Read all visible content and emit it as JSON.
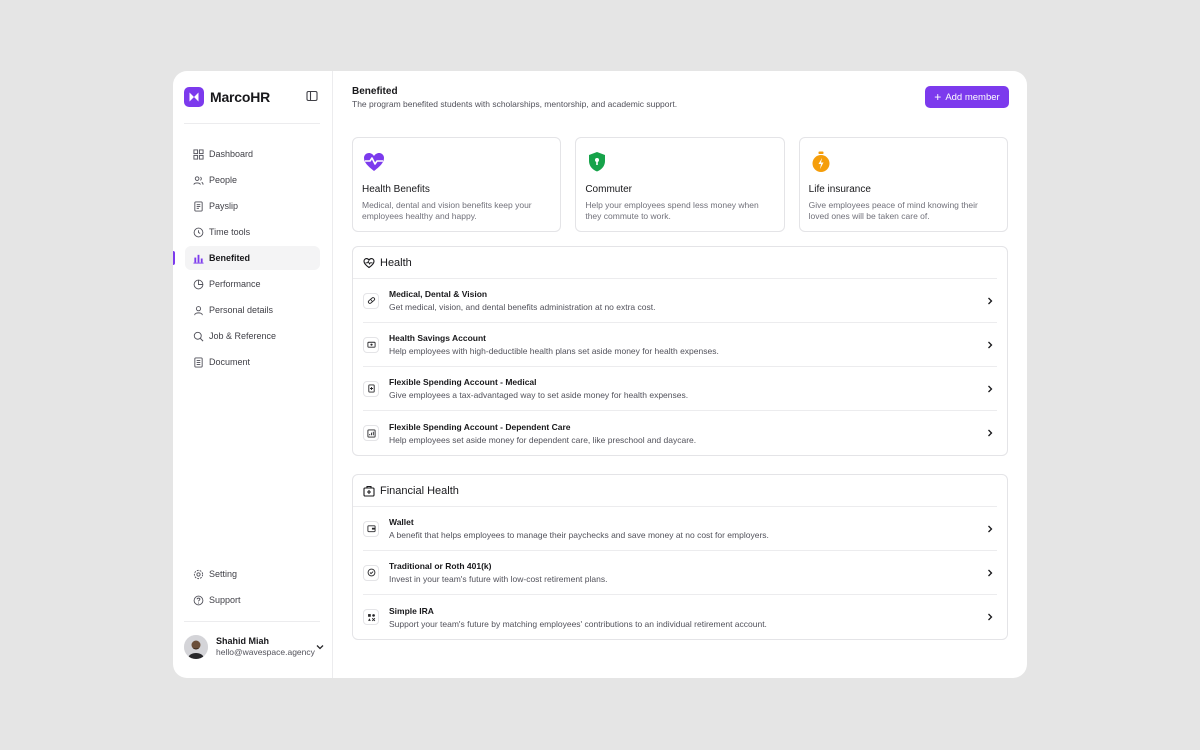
{
  "brand": {
    "name": "MarcoHR"
  },
  "nav": {
    "items": [
      {
        "label": "Dashboard",
        "icon": "grid-icon"
      },
      {
        "label": "People",
        "icon": "users-icon"
      },
      {
        "label": "Payslip",
        "icon": "receipt-icon"
      },
      {
        "label": "Time tools",
        "icon": "clock-icon"
      },
      {
        "label": "Benefited",
        "icon": "bar-chart-icon",
        "active": true
      },
      {
        "label": "Performance",
        "icon": "pie-chart-icon"
      },
      {
        "label": "Personal details",
        "icon": "user-icon"
      },
      {
        "label": "Job & Reference",
        "icon": "search-icon"
      },
      {
        "label": "Document",
        "icon": "document-icon"
      }
    ],
    "bottom": [
      {
        "label": "Setting",
        "icon": "gear-icon"
      },
      {
        "label": "Support",
        "icon": "help-icon"
      }
    ]
  },
  "user": {
    "name": "Shahid Miah",
    "email": "hello@wavespace.agency"
  },
  "header": {
    "title": "Benefited",
    "subtitle": "The program benefited students with scholarships, mentorship, and academic support.",
    "add_button": "Add member"
  },
  "cards": [
    {
      "title": "Health Benefits",
      "desc": "Medical, dental and vision benefits keep your employees healthy and happy.",
      "icon": "heart-pulse-icon",
      "color": "#7c3aed"
    },
    {
      "title": "Commuter",
      "desc": "Help your employees spend less money when they commute to work.",
      "icon": "shield-icon",
      "color": "#16a34a"
    },
    {
      "title": "Life insurance",
      "desc": "Give employees peace of mind knowing their loved ones will be taken care of.",
      "icon": "stopwatch-icon",
      "color": "#f59e0b"
    }
  ],
  "health": {
    "title": "Health",
    "rows": [
      {
        "title": "Medical, Dental & Vision",
        "desc": "Get medical, vision, and dental benefits administration at no extra cost.",
        "icon": "pill-icon"
      },
      {
        "title": "Health Savings Account",
        "desc": "Help employees with high-deductible health plans set aside money for health expenses.",
        "icon": "wallet-card-icon"
      },
      {
        "title": "Flexible Spending Account - Medical",
        "desc": "Give employees a tax-advantaged way to set aside money for health expenses.",
        "icon": "medical-file-icon"
      },
      {
        "title": "Flexible Spending Account - Dependent Care",
        "desc": "Help employees set aside money for dependent care, like preschool and daycare.",
        "icon": "chart-box-icon"
      }
    ]
  },
  "financial": {
    "title": "Financial Health",
    "rows": [
      {
        "title": "Wallet",
        "desc": "A benefit that helps employees to manage their paychecks and save money at no cost for employers.",
        "icon": "wallet-icon"
      },
      {
        "title": "Traditional or Roth 401(k)",
        "desc": "Invest in your team's future with low-cost retirement plans.",
        "icon": "check-circle-icon"
      },
      {
        "title": "Simple IRA",
        "desc": "Support your team's future by matching employees' contributions to an individual retirement account.",
        "icon": "shapes-icon"
      }
    ]
  },
  "colors": {
    "accent": "#7c3aed",
    "border": "#e4e4e7",
    "background": "#e5e5e5"
  }
}
